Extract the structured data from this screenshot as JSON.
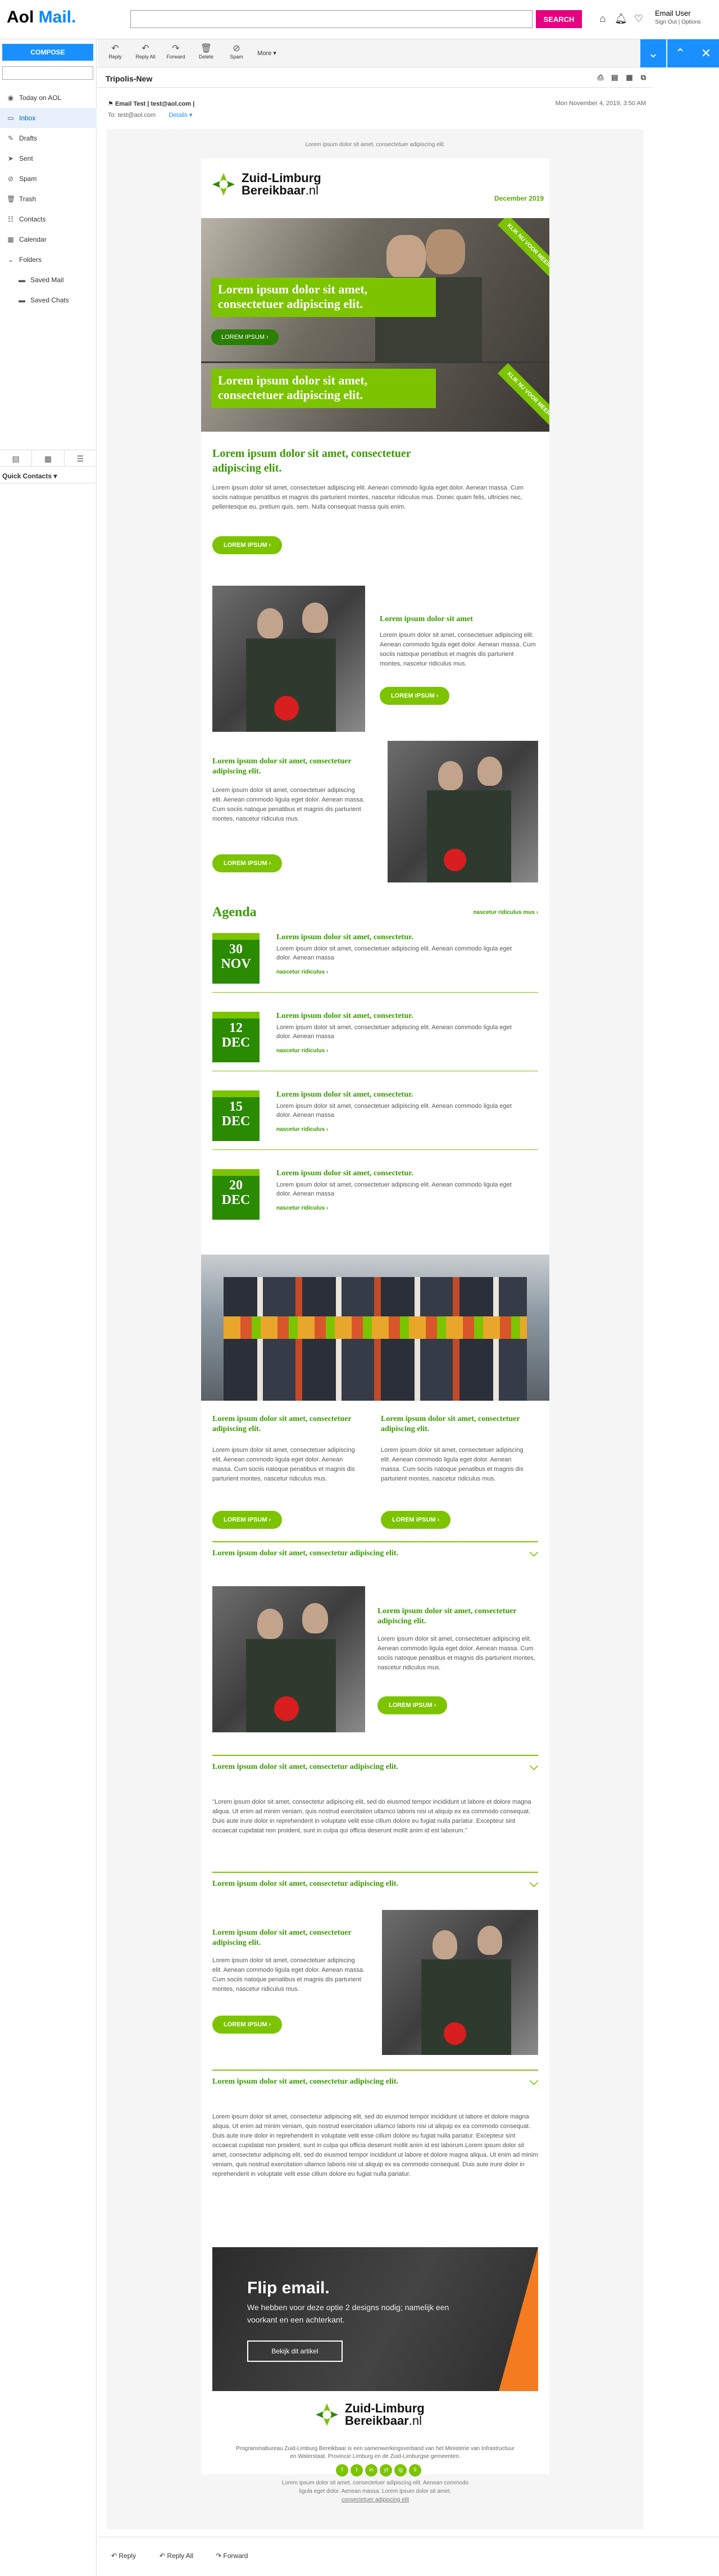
{
  "app": {
    "logo_brand": "Aol",
    "logo_product": "Mail."
  },
  "search": {
    "placeholder": "",
    "button": "SEARCH"
  },
  "user": {
    "name": "Email User",
    "links": "Sign Out  |  Options"
  },
  "sidebar": {
    "compose": "COMPOSE",
    "items": [
      {
        "label": "Today on AOL",
        "icon": "aol-icon"
      },
      {
        "label": "Inbox",
        "icon": "inbox-icon"
      },
      {
        "label": "Drafts",
        "icon": "drafts-icon"
      },
      {
        "label": "Sent",
        "icon": "sent-icon"
      },
      {
        "label": "Spam",
        "icon": "spam-icon"
      },
      {
        "label": "Trash",
        "icon": "trash-icon"
      },
      {
        "label": "Contacts",
        "icon": "contacts-icon"
      },
      {
        "label": "Calendar",
        "icon": "calendar-icon"
      },
      {
        "label": "Folders",
        "icon": "folder-icon"
      },
      {
        "label": "Saved Mail",
        "icon": "folder-icon"
      },
      {
        "label": "Saved Chats",
        "icon": "folder-icon"
      }
    ],
    "quick_contacts": "Quick Contacts"
  },
  "toolbar": {
    "reply": "Reply",
    "reply_all": "Reply All",
    "forward": "Forward",
    "delete": "Delete",
    "spam": "Spam",
    "more": "More"
  },
  "message": {
    "subject": "Tripolis-New",
    "from": "Email Test | test@aol.com |",
    "to_label": "To:",
    "to": "test@aol.com",
    "details": "Details",
    "date": "Mon November 4, 2019, 3:50 AM"
  },
  "email": {
    "preheader": "Lorem ipsum dolor sit amet, consectetuer adipiscing elit.",
    "brand_line1": "Zuid-Limburg",
    "brand_line2": "Bereikbaar",
    "brand_tld": ".nl",
    "date_label": "December 2019",
    "hero": {
      "title1": "Lorem ipsum dolor sit amet, consectetuer adipiscing elit.",
      "btn1": "LOREM IPSUM  ›",
      "title2": "Lorem ipsum dolor sit amet, consectetuer adipiscing elit.",
      "ribbon1": "KLIK NU VOOR MEER",
      "ribbon2": "KLIK NU VOOR MEER"
    },
    "intro": {
      "title": "Lorem ipsum dolor sit amet, consectetuer adipiscing elit.",
      "text": "Lorem ipsum dolor sit amet, consectetuer adipiscing elit. Aenean commodo ligula eget dolor. Aenean massa. Cum sociis natoque penatibus et magnis dis parturient montes, nascetur ridiculus mus. Donec quam felis, ultricies nec, pellentesque eu, pretium quis, sem. Nulla consequat massa quis enim.",
      "btn": "LOREM IPSUM  ›"
    },
    "block1": {
      "title": "Lorem ipsum dolor sit amet",
      "text": "Lorem ipsum dolor sit amet, consectetuer adipiscing elit. Aenean commodo ligula eget dolor. Aenean massa. Cum sociis natoque penatibus et magnis dis parturient montes, nascetur ridiculus mus.",
      "btn": "LOREM IPSUM  ›"
    },
    "block2": {
      "title": "Lorem ipsum dolor sit amet, consectetuer adipiscing elit.",
      "text": "Lorem ipsum dolor sit amet, consectetuer adipiscing elit. Aenean commodo ligula eget dolor. Aenean massa. Cum sociis natoque penatibus et magnis dis parturient montes, nascetur ridiculus mus.",
      "btn": "LOREM IPSUM  ›"
    },
    "agenda": {
      "title": "Agenda",
      "link": "nascetur ridiculus mus  ›",
      "items": [
        {
          "day": "30",
          "month": "NOV",
          "title": "Lorem ipsum dolor sit amet, consectetur.",
          "text": "Lorem ipsum dolor sit amet, consectetuer adipiscing elit. Aenean commodo ligula eget dolor. Aenean massa",
          "link": "nascetur ridiculus  ›"
        },
        {
          "day": "12",
          "month": "DEC",
          "title": "Lorem ipsum dolor sit amet, consectetur.",
          "text": "Lorem ipsum dolor sit amet, consectetuer adipiscing elit. Aenean commodo ligula eget dolor. Aenean massa",
          "link": "nascetur ridiculus  ›"
        },
        {
          "day": "15",
          "month": "DEC",
          "title": "Lorem ipsum dolor sit amet, consectetur.",
          "text": "Lorem ipsum dolor sit amet, consectetuer adipiscing elit. Aenean commodo ligula eget dolor. Aenean massa",
          "link": "nascetur ridiculus  ›"
        },
        {
          "day": "20",
          "month": "DEC",
          "title": "Lorem ipsum dolor sit amet, consectetur.",
          "text": "Lorem ipsum dolor sit amet, consectetuer adipiscing elit. Aenean commodo ligula eget dolor. Aenean massa",
          "link": "nascetur ridiculus  ›"
        }
      ]
    },
    "cols": [
      {
        "title": "Lorem ipsum dolor sit amet, consectetuer adipiscing elit.",
        "text": "Lorem ipsum dolor sit amet, consectetuer adipiscing elit. Aenean commodo ligula eget dolor. Aenean massa. Cum sociis natoque penatibus et magnis dis parturient montes, nascetur ridiculus mus.",
        "btn": "LOREM IPSUM  ›"
      },
      {
        "title": "Lorem ipsum dolor sit amet, consectetuer adipiscing elit.",
        "text": "Lorem ipsum dolor sit amet, consectetuer adipiscing elit. Aenean commodo ligula eget dolor. Aenean massa. Cum sociis natoque penatibus et magnis dis parturient montes, nascetur ridiculus mus.",
        "btn": "LOREM IPSUM  ›"
      }
    ],
    "acc1": "Lorem ipsum dolor sit amet, consectetur adipiscing elit.",
    "block3": {
      "title": "Lorem ipsum dolor sit amet, consectetuer adipiscing elit.",
      "text": "Lorem ipsum dolor sit amet, consectetuer adipiscing elit. Aenean commodo ligula eget dolor. Aenean massa. Cum sociis natoque penatibus et magnis dis parturient montes, nascetur ridiculus mus.",
      "btn": "LOREM IPSUM  ›"
    },
    "acc2": "Lorem ipsum dolor sit amet, consectetur adipiscing elit.",
    "quote": "\"Lorem ipsum dolor sit amet, consectetur adipiscing elit, sed do eiusmod tempor incididunt ut labore et dolore magna aliqua. Ut enim ad minim veniam, quis nostrud exercitation ullamco laboris nisi ut aliquip ex ea commodo consequat. Duis aute irure dolor in reprehenderit in voluptate velit esse cillum dolore eu fugiat nulla pariatur. Excepteur sint occaecat cupidatat non proident, sunt in culpa qui officia deserunt mollit anim id est laborum.\"",
    "acc3": "Lorem ipsum dolor sit amet, consectetur adipiscing elit.",
    "block4": {
      "title": "Lorem ipsum dolor sit amet, consectetuer adipiscing elit.",
      "text": "Lorem ipsum dolor sit amet, consectetuer adipiscing elit. Aenean commodo ligula eget dolor. Aenean massa. Cum sociis natoque penatibus et magnis dis parturient montes, nascetur ridiculus mus.",
      "btn": "LOREM IPSUM  ›"
    },
    "acc4": "Lorem ipsum dolor sit amet, consectetur adipiscing elit.",
    "long_text": "Lorem ipsum dolor sit amet, consectetur adipiscing elit, sed do eiusmod tempor incididunt ut labore et dolore magna aliqua. Ut enim ad minim veniam, quis nostrud exercitation ullamco laboris nisi ut aliquip ex ea commodo consequat. Duis aute irure dolor in reprehenderit in voluptate velit esse cillum dolore eu fugiat nulla pariatur. Excepteur sint occaecat cupidatat non proident, sunt in culpa qui officia deserunt mollit anim id est laborum.Lorem ipsum dolor sit amet, consectetur adipiscing elit, sed do eiusmod tempor incididunt ut labore et dolore magna aliqua. Ut enim ad minim veniam, quis nostrud exercitation ullamco laboris nisi ut aliquip ex ea commodo consequat. Duis aute irure dolor in reprehenderit in voluptate velit esse cillum dolore eu fugiat nulla pariatur.",
    "flip": {
      "title": "Flip email.",
      "sub": "We hebben voor deze optie 2 designs nodig; namelijk een voorkant en een achterkant.",
      "btn": "Bekijk dit artikel"
    },
    "footer": "Programmabureau Zuid-Limburg Bereikbaar is een samenwerkingsverband van het Ministerie van Infrastructuur en Waterstaat, Provincie Limburg en de Zuid-Limburgse gemeenten.",
    "social": [
      "f",
      "t",
      "in",
      "yt",
      "ig",
      "li"
    ],
    "email_foot1": "Lorem ipsum dolor sit amet, consectetuer adipiscing elit. Aenean commodo",
    "email_foot2": "ligula eget dolor. Aenean massa. Lorem ipsum dolor sit amet.",
    "email_foot3": "consectetuer adipiscing elit"
  },
  "reply_bar": {
    "reply": "Reply",
    "reply_all": "Reply All",
    "forward": "Forward"
  },
  "colors": {
    "accent": "#7cc400",
    "dark_green": "#2a8a00",
    "aol_blue": "#1a90ff",
    "search_pink": "#e4007f"
  }
}
